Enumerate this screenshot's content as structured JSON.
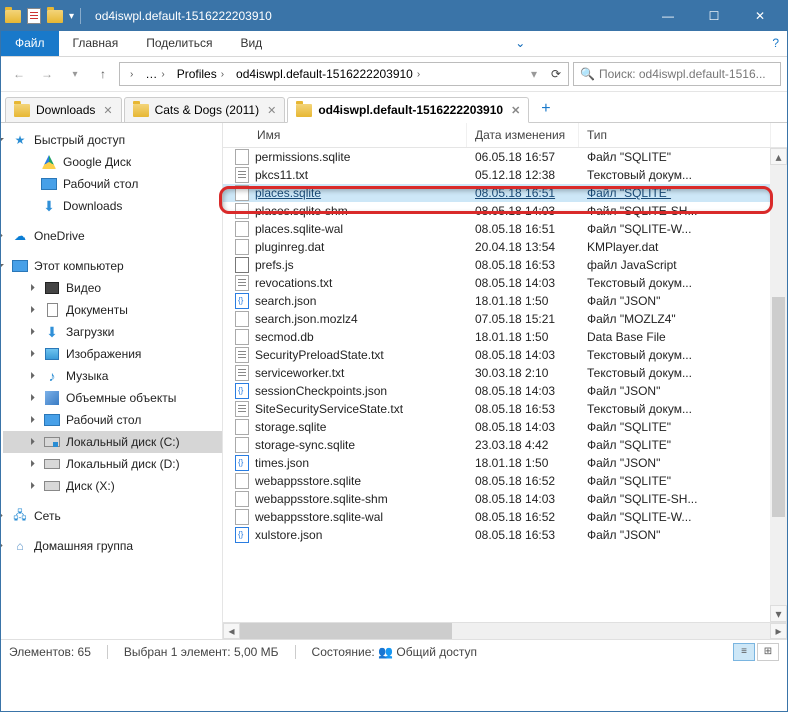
{
  "window": {
    "title": "od4iswpl.default-1516222203910"
  },
  "ribbon": {
    "file": "Файл",
    "home": "Главная",
    "share": "Поделиться",
    "view": "Вид"
  },
  "address": {
    "segments": [
      "Profiles",
      "od4iswpl.default-1516222203910"
    ],
    "refresh_tip": "Обновить"
  },
  "search": {
    "placeholder": "Поиск: od4iswpl.default-1516..."
  },
  "tabs": [
    {
      "label": "Downloads",
      "active": false
    },
    {
      "label": "Cats & Dogs (2011)",
      "active": false
    },
    {
      "label": "od4iswpl.default-1516222203910",
      "active": true
    }
  ],
  "columns": {
    "name": "Имя",
    "date": "Дата изменения",
    "type": "Тип"
  },
  "sidebar": {
    "quick": "Быстрый доступ",
    "gdrive": "Google Диск",
    "desktop": "Рабочий стол",
    "downloads": "Downloads",
    "onedrive": "OneDrive",
    "thispc": "Этот компьютер",
    "video": "Видео",
    "documents": "Документы",
    "downloads2": "Загрузки",
    "pictures": "Изображения",
    "music": "Музыка",
    "objects3d": "Объемные объекты",
    "desktop2": "Рабочий стол",
    "drivec": "Локальный диск (C:)",
    "drived": "Локальный диск (D:)",
    "drivex": "Диск (X:)",
    "network": "Сеть",
    "homegroup": "Домашняя группа"
  },
  "files": [
    {
      "name": "permissions.sqlite",
      "date": "06.05.18 16:57",
      "type": "Файл \"SQLITE\"",
      "icon": "blank"
    },
    {
      "name": "pkcs11.txt",
      "date": "05.12.18 12:38",
      "type": "Текстовый докум...",
      "icon": "txt"
    },
    {
      "name": "places.sqlite",
      "date": "08.05.18 16:51",
      "type": "Файл \"SQLITE\"",
      "icon": "blank",
      "selected": true
    },
    {
      "name": "places.sqlite-shm",
      "date": "08.05.18 14:03",
      "type": "Файл \"SQLITE-SH...",
      "icon": "blank"
    },
    {
      "name": "places.sqlite-wal",
      "date": "08.05.18 16:51",
      "type": "Файл \"SQLITE-W...",
      "icon": "blank"
    },
    {
      "name": "pluginreg.dat",
      "date": "20.04.18 13:54",
      "type": "KMPlayer.dat",
      "icon": "blank"
    },
    {
      "name": "prefs.js",
      "date": "08.05.18 16:53",
      "type": "файл JavaScript",
      "icon": "js"
    },
    {
      "name": "revocations.txt",
      "date": "08.05.18 14:03",
      "type": "Текстовый докум...",
      "icon": "txt"
    },
    {
      "name": "search.json",
      "date": "18.01.18 1:50",
      "type": "Файл \"JSON\"",
      "icon": "json"
    },
    {
      "name": "search.json.mozlz4",
      "date": "07.05.18 15:21",
      "type": "Файл \"MOZLZ4\"",
      "icon": "blank"
    },
    {
      "name": "secmod.db",
      "date": "18.01.18 1:50",
      "type": "Data Base File",
      "icon": "blank"
    },
    {
      "name": "SecurityPreloadState.txt",
      "date": "08.05.18 14:03",
      "type": "Текстовый докум...",
      "icon": "txt"
    },
    {
      "name": "serviceworker.txt",
      "date": "30.03.18 2:10",
      "type": "Текстовый докум...",
      "icon": "txt"
    },
    {
      "name": "sessionCheckpoints.json",
      "date": "08.05.18 14:03",
      "type": "Файл \"JSON\"",
      "icon": "json"
    },
    {
      "name": "SiteSecurityServiceState.txt",
      "date": "08.05.18 16:53",
      "type": "Текстовый докум...",
      "icon": "txt"
    },
    {
      "name": "storage.sqlite",
      "date": "08.05.18 14:03",
      "type": "Файл \"SQLITE\"",
      "icon": "blank"
    },
    {
      "name": "storage-sync.sqlite",
      "date": "23.03.18 4:42",
      "type": "Файл \"SQLITE\"",
      "icon": "blank"
    },
    {
      "name": "times.json",
      "date": "18.01.18 1:50",
      "type": "Файл \"JSON\"",
      "icon": "json"
    },
    {
      "name": "webappsstore.sqlite",
      "date": "08.05.18 16:52",
      "type": "Файл \"SQLITE\"",
      "icon": "blank"
    },
    {
      "name": "webappsstore.sqlite-shm",
      "date": "08.05.18 14:03",
      "type": "Файл \"SQLITE-SH...",
      "icon": "blank"
    },
    {
      "name": "webappsstore.sqlite-wal",
      "date": "08.05.18 16:52",
      "type": "Файл \"SQLITE-W...",
      "icon": "blank"
    },
    {
      "name": "xulstore.json",
      "date": "08.05.18 16:53",
      "type": "Файл \"JSON\"",
      "icon": "json"
    }
  ],
  "status": {
    "count_label": "Элементов:",
    "count": "65",
    "selected_label": "Выбран 1 элемент: 5,00 МБ",
    "state_label": "Состояние:",
    "share_label": "Общий доступ"
  }
}
